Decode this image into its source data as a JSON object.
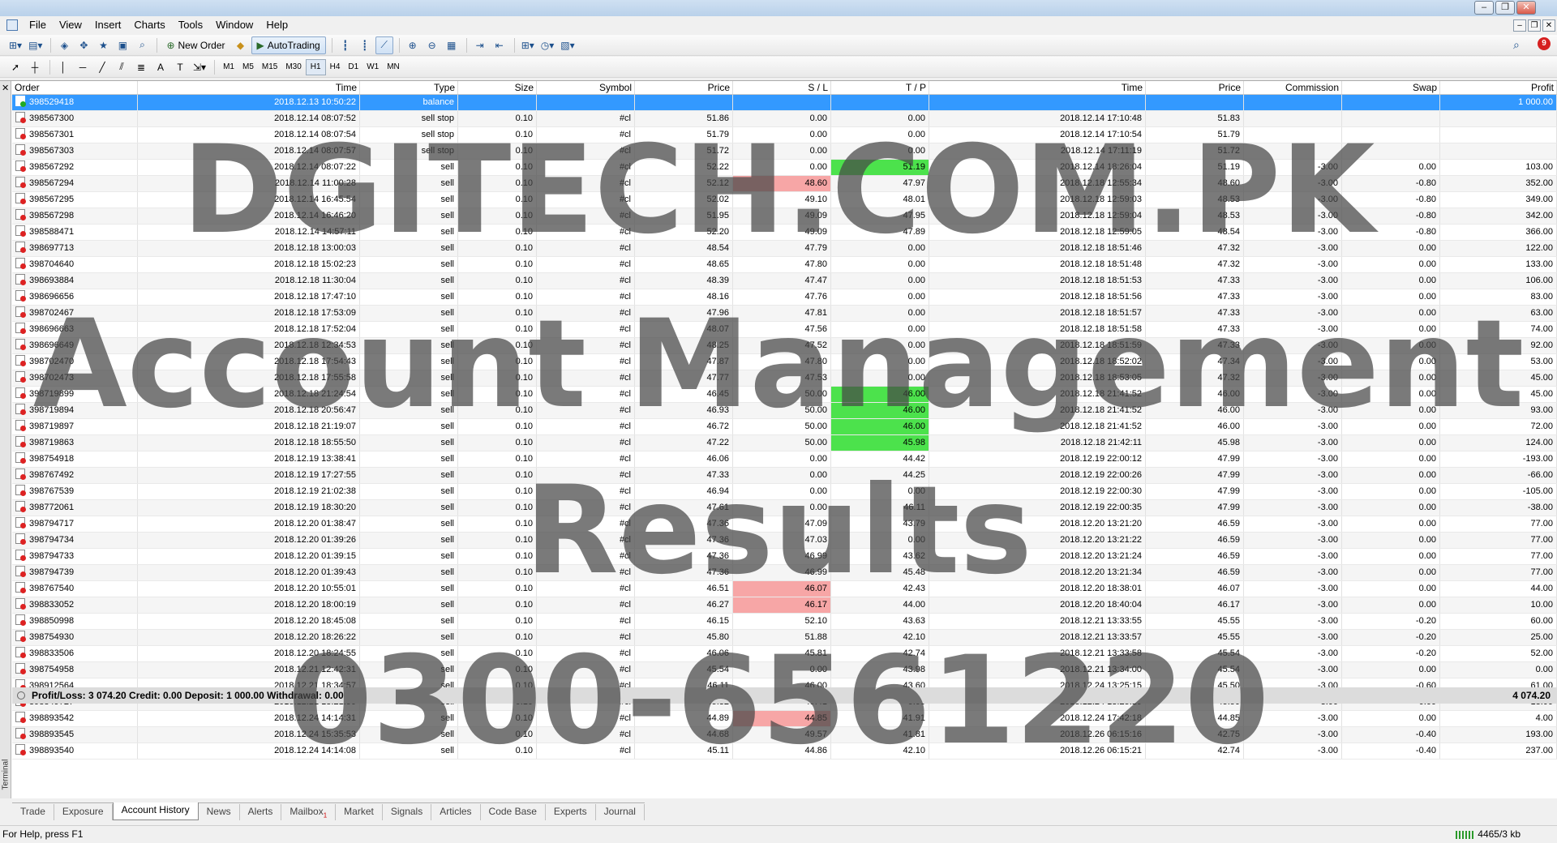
{
  "window_controls": [
    "–",
    "❐",
    "✕"
  ],
  "mdi_controls": [
    "–",
    "❐",
    "✕"
  ],
  "menu": [
    "File",
    "View",
    "Insert",
    "Charts",
    "Tools",
    "Window",
    "Help"
  ],
  "toolbar": {
    "new_order": "New Order",
    "autotrading": "AutoTrading",
    "timeframes": [
      "M1",
      "M5",
      "M15",
      "M30",
      "H1",
      "H4",
      "D1",
      "W1",
      "MN"
    ],
    "active_timeframe": "H1"
  },
  "notifications": {
    "count": "9"
  },
  "columns": [
    "Order",
    "Time",
    "Type",
    "Size",
    "Symbol",
    "Price",
    "S / L",
    "T / P",
    "Time",
    "Price",
    "Commission",
    "Swap",
    "Profit"
  ],
  "rows": [
    {
      "order": "398529418",
      "time": "2018.12.13 10:50:22",
      "type": "balance",
      "size": "",
      "symbol": "",
      "price": "",
      "sl": "",
      "tp": "",
      "ctime": "",
      "cprice": "",
      "commission": "",
      "swap": "",
      "profit": "1 000.00",
      "sel": true,
      "icon": "bal"
    },
    {
      "order": "398567300",
      "time": "2018.12.14 08:07:52",
      "type": "sell stop",
      "size": "0.10",
      "symbol": "#cl",
      "price": "51.86",
      "sl": "0.00",
      "tp": "0.00",
      "ctime": "2018.12.14 17:10:48",
      "cprice": "51.83",
      "commission": "",
      "swap": "",
      "profit": ""
    },
    {
      "order": "398567301",
      "time": "2018.12.14 08:07:54",
      "type": "sell stop",
      "size": "0.10",
      "symbol": "#cl",
      "price": "51.79",
      "sl": "0.00",
      "tp": "0.00",
      "ctime": "2018.12.14 17:10:54",
      "cprice": "51.79",
      "commission": "",
      "swap": "",
      "profit": ""
    },
    {
      "order": "398567303",
      "time": "2018.12.14 08:07:57",
      "type": "sell stop",
      "size": "0.10",
      "symbol": "#cl",
      "price": "51.72",
      "sl": "0.00",
      "tp": "0.00",
      "ctime": "2018.12.14 17:11:19",
      "cprice": "51.72",
      "commission": "",
      "swap": "",
      "profit": ""
    },
    {
      "order": "398567292",
      "time": "2018.12.14 08:07:22",
      "type": "sell",
      "size": "0.10",
      "symbol": "#cl",
      "price": "52.22",
      "sl": "0.00",
      "tp": "51.19",
      "ctime": "2018.12.14 18:26:04",
      "cprice": "51.19",
      "commission": "-3.00",
      "swap": "0.00",
      "profit": "103.00",
      "tphit": true
    },
    {
      "order": "398567294",
      "time": "2018.12.14 11:00:28",
      "type": "sell",
      "size": "0.10",
      "symbol": "#cl",
      "price": "52.12",
      "sl": "48.60",
      "tp": "47.97",
      "ctime": "2018.12.18 12:55:34",
      "cprice": "48.60",
      "commission": "-3.00",
      "swap": "-0.80",
      "profit": "352.00",
      "slhit": true
    },
    {
      "order": "398567295",
      "time": "2018.12.14 16:45:54",
      "type": "sell",
      "size": "0.10",
      "symbol": "#cl",
      "price": "52.02",
      "sl": "49.10",
      "tp": "48.01",
      "ctime": "2018.12.18 12:59:03",
      "cprice": "48.53",
      "commission": "-3.00",
      "swap": "-0.80",
      "profit": "349.00"
    },
    {
      "order": "398567298",
      "time": "2018.12.14 16:46:20",
      "type": "sell",
      "size": "0.10",
      "symbol": "#cl",
      "price": "51.95",
      "sl": "49.09",
      "tp": "47.95",
      "ctime": "2018.12.18 12:59:04",
      "cprice": "48.53",
      "commission": "-3.00",
      "swap": "-0.80",
      "profit": "342.00"
    },
    {
      "order": "398588471",
      "time": "2018.12.14 14:57:11",
      "type": "sell",
      "size": "0.10",
      "symbol": "#cl",
      "price": "52.20",
      "sl": "49.09",
      "tp": "47.89",
      "ctime": "2018.12.18 12:59:05",
      "cprice": "48.54",
      "commission": "-3.00",
      "swap": "-0.80",
      "profit": "366.00"
    },
    {
      "order": "398697713",
      "time": "2018.12.18 13:00:03",
      "type": "sell",
      "size": "0.10",
      "symbol": "#cl",
      "price": "48.54",
      "sl": "47.79",
      "tp": "0.00",
      "ctime": "2018.12.18 18:51:46",
      "cprice": "47.32",
      "commission": "-3.00",
      "swap": "0.00",
      "profit": "122.00"
    },
    {
      "order": "398704640",
      "time": "2018.12.18 15:02:23",
      "type": "sell",
      "size": "0.10",
      "symbol": "#cl",
      "price": "48.65",
      "sl": "47.80",
      "tp": "0.00",
      "ctime": "2018.12.18 18:51:48",
      "cprice": "47.32",
      "commission": "-3.00",
      "swap": "0.00",
      "profit": "133.00"
    },
    {
      "order": "398693884",
      "time": "2018.12.18 11:30:04",
      "type": "sell",
      "size": "0.10",
      "symbol": "#cl",
      "price": "48.39",
      "sl": "47.47",
      "tp": "0.00",
      "ctime": "2018.12.18 18:51:53",
      "cprice": "47.33",
      "commission": "-3.00",
      "swap": "0.00",
      "profit": "106.00"
    },
    {
      "order": "398696656",
      "time": "2018.12.18 17:47:10",
      "type": "sell",
      "size": "0.10",
      "symbol": "#cl",
      "price": "48.16",
      "sl": "47.76",
      "tp": "0.00",
      "ctime": "2018.12.18 18:51:56",
      "cprice": "47.33",
      "commission": "-3.00",
      "swap": "0.00",
      "profit": "83.00"
    },
    {
      "order": "398702467",
      "time": "2018.12.18 17:53:09",
      "type": "sell",
      "size": "0.10",
      "symbol": "#cl",
      "price": "47.96",
      "sl": "47.81",
      "tp": "0.00",
      "ctime": "2018.12.18 18:51:57",
      "cprice": "47.33",
      "commission": "-3.00",
      "swap": "0.00",
      "profit": "63.00"
    },
    {
      "order": "398696663",
      "time": "2018.12.18 17:52:04",
      "type": "sell",
      "size": "0.10",
      "symbol": "#cl",
      "price": "48.07",
      "sl": "47.56",
      "tp": "0.00",
      "ctime": "2018.12.18 18:51:58",
      "cprice": "47.33",
      "commission": "-3.00",
      "swap": "0.00",
      "profit": "74.00"
    },
    {
      "order": "398696649",
      "time": "2018.12.18 12:34:53",
      "type": "sell",
      "size": "0.10",
      "symbol": "#cl",
      "price": "48.25",
      "sl": "47.52",
      "tp": "0.00",
      "ctime": "2018.12.18 18:51:59",
      "cprice": "47.33",
      "commission": "-3.00",
      "swap": "0.00",
      "profit": "92.00"
    },
    {
      "order": "398702470",
      "time": "2018.12.18 17:54:43",
      "type": "sell",
      "size": "0.10",
      "symbol": "#cl",
      "price": "47.87",
      "sl": "47.80",
      "tp": "0.00",
      "ctime": "2018.12.18 18:52:02",
      "cprice": "47.34",
      "commission": "-3.00",
      "swap": "0.00",
      "profit": "53.00"
    },
    {
      "order": "398702473",
      "time": "2018.12.18 17:55:58",
      "type": "sell",
      "size": "0.10",
      "symbol": "#cl",
      "price": "47.77",
      "sl": "47.53",
      "tp": "0.00",
      "ctime": "2018.12.18 18:53:05",
      "cprice": "47.32",
      "commission": "-3.00",
      "swap": "0.00",
      "profit": "45.00"
    },
    {
      "order": "398719899",
      "time": "2018.12.18 21:24:54",
      "type": "sell",
      "size": "0.10",
      "symbol": "#cl",
      "price": "46.45",
      "sl": "50.00",
      "tp": "46.00",
      "ctime": "2018.12.18 21:41:52",
      "cprice": "46.00",
      "commission": "-3.00",
      "swap": "0.00",
      "profit": "45.00",
      "tphit": true
    },
    {
      "order": "398719894",
      "time": "2018.12.18 20:56:47",
      "type": "sell",
      "size": "0.10",
      "symbol": "#cl",
      "price": "46.93",
      "sl": "50.00",
      "tp": "46.00",
      "ctime": "2018.12.18 21:41:52",
      "cprice": "46.00",
      "commission": "-3.00",
      "swap": "0.00",
      "profit": "93.00",
      "tphit": true
    },
    {
      "order": "398719897",
      "time": "2018.12.18 21:19:07",
      "type": "sell",
      "size": "0.10",
      "symbol": "#cl",
      "price": "46.72",
      "sl": "50.00",
      "tp": "46.00",
      "ctime": "2018.12.18 21:41:52",
      "cprice": "46.00",
      "commission": "-3.00",
      "swap": "0.00",
      "profit": "72.00",
      "tphit": true
    },
    {
      "order": "398719863",
      "time": "2018.12.18 18:55:50",
      "type": "sell",
      "size": "0.10",
      "symbol": "#cl",
      "price": "47.22",
      "sl": "50.00",
      "tp": "45.98",
      "ctime": "2018.12.18 21:42:11",
      "cprice": "45.98",
      "commission": "-3.00",
      "swap": "0.00",
      "profit": "124.00",
      "tphit": true
    },
    {
      "order": "398754918",
      "time": "2018.12.19 13:38:41",
      "type": "sell",
      "size": "0.10",
      "symbol": "#cl",
      "price": "46.06",
      "sl": "0.00",
      "tp": "44.42",
      "ctime": "2018.12.19 22:00:12",
      "cprice": "47.99",
      "commission": "-3.00",
      "swap": "0.00",
      "profit": "-193.00"
    },
    {
      "order": "398767492",
      "time": "2018.12.19 17:27:55",
      "type": "sell",
      "size": "0.10",
      "symbol": "#cl",
      "price": "47.33",
      "sl": "0.00",
      "tp": "44.25",
      "ctime": "2018.12.19 22:00:26",
      "cprice": "47.99",
      "commission": "-3.00",
      "swap": "0.00",
      "profit": "-66.00"
    },
    {
      "order": "398767539",
      "time": "2018.12.19 21:02:38",
      "type": "sell",
      "size": "0.10",
      "symbol": "#cl",
      "price": "46.94",
      "sl": "0.00",
      "tp": "0.00",
      "ctime": "2018.12.19 22:00:30",
      "cprice": "47.99",
      "commission": "-3.00",
      "swap": "0.00",
      "profit": "-105.00"
    },
    {
      "order": "398772061",
      "time": "2018.12.19 18:30:20",
      "type": "sell",
      "size": "0.10",
      "symbol": "#cl",
      "price": "47.61",
      "sl": "0.00",
      "tp": "46.11",
      "ctime": "2018.12.19 22:00:35",
      "cprice": "47.99",
      "commission": "-3.00",
      "swap": "0.00",
      "profit": "-38.00"
    },
    {
      "order": "398794717",
      "time": "2018.12.20 01:38:47",
      "type": "sell",
      "size": "0.10",
      "symbol": "#cl",
      "price": "47.36",
      "sl": "47.09",
      "tp": "43.79",
      "ctime": "2018.12.20 13:21:20",
      "cprice": "46.59",
      "commission": "-3.00",
      "swap": "0.00",
      "profit": "77.00"
    },
    {
      "order": "398794734",
      "time": "2018.12.20 01:39:26",
      "type": "sell",
      "size": "0.10",
      "symbol": "#cl",
      "price": "47.36",
      "sl": "47.03",
      "tp": "0.00",
      "ctime": "2018.12.20 13:21:22",
      "cprice": "46.59",
      "commission": "-3.00",
      "swap": "0.00",
      "profit": "77.00"
    },
    {
      "order": "398794733",
      "time": "2018.12.20 01:39:15",
      "type": "sell",
      "size": "0.10",
      "symbol": "#cl",
      "price": "47.36",
      "sl": "46.99",
      "tp": "43.62",
      "ctime": "2018.12.20 13:21:24",
      "cprice": "46.59",
      "commission": "-3.00",
      "swap": "0.00",
      "profit": "77.00"
    },
    {
      "order": "398794739",
      "time": "2018.12.20 01:39:43",
      "type": "sell",
      "size": "0.10",
      "symbol": "#cl",
      "price": "47.36",
      "sl": "46.99",
      "tp": "45.48",
      "ctime": "2018.12.20 13:21:34",
      "cprice": "46.59",
      "commission": "-3.00",
      "swap": "0.00",
      "profit": "77.00"
    },
    {
      "order": "398767540",
      "time": "2018.12.20 10:55:01",
      "type": "sell",
      "size": "0.10",
      "symbol": "#cl",
      "price": "46.51",
      "sl": "46.07",
      "tp": "42.43",
      "ctime": "2018.12.20 18:38:01",
      "cprice": "46.07",
      "commission": "-3.00",
      "swap": "0.00",
      "profit": "44.00",
      "slhit": true
    },
    {
      "order": "398833052",
      "time": "2018.12.20 18:00:19",
      "type": "sell",
      "size": "0.10",
      "symbol": "#cl",
      "price": "46.27",
      "sl": "46.17",
      "tp": "44.00",
      "ctime": "2018.12.20 18:40:04",
      "cprice": "46.17",
      "commission": "-3.00",
      "swap": "0.00",
      "profit": "10.00",
      "slhit": true
    },
    {
      "order": "398850998",
      "time": "2018.12.20 18:45:08",
      "type": "sell",
      "size": "0.10",
      "symbol": "#cl",
      "price": "46.15",
      "sl": "52.10",
      "tp": "43.63",
      "ctime": "2018.12.21 13:33:55",
      "cprice": "45.55",
      "commission": "-3.00",
      "swap": "-0.20",
      "profit": "60.00"
    },
    {
      "order": "398754930",
      "time": "2018.12.20 18:26:22",
      "type": "sell",
      "size": "0.10",
      "symbol": "#cl",
      "price": "45.80",
      "sl": "51.88",
      "tp": "42.10",
      "ctime": "2018.12.21 13:33:57",
      "cprice": "45.55",
      "commission": "-3.00",
      "swap": "-0.20",
      "profit": "25.00"
    },
    {
      "order": "398833506",
      "time": "2018.12.20 18:24:55",
      "type": "sell",
      "size": "0.10",
      "symbol": "#cl",
      "price": "46.06",
      "sl": "45.81",
      "tp": "42.74",
      "ctime": "2018.12.21 13:33:58",
      "cprice": "45.54",
      "commission": "-3.00",
      "swap": "-0.20",
      "profit": "52.00"
    },
    {
      "order": "398754958",
      "time": "2018.12.21 12:42:31",
      "type": "sell",
      "size": "0.10",
      "symbol": "#cl",
      "price": "45.54",
      "sl": "0.00",
      "tp": "43.98",
      "ctime": "2018.12.21 13:34:00",
      "cprice": "45.54",
      "commission": "-3.00",
      "swap": "0.00",
      "profit": "0.00"
    },
    {
      "order": "398912564",
      "time": "2018.12.21 18:34:57",
      "type": "sell",
      "size": "0.10",
      "symbol": "#cl",
      "price": "46.11",
      "sl": "46.00",
      "tp": "43.60",
      "ctime": "2018.12.24 13:25:15",
      "cprice": "45.50",
      "commission": "-3.00",
      "swap": "-0.60",
      "profit": "61.00"
    },
    {
      "order": "398849727",
      "time": "2018.12.21 13:21:50",
      "type": "sell",
      "size": "0.10",
      "symbol": "#cl",
      "price": "45.32",
      "sl": "49.41",
      "tp": "0.00",
      "ctime": "2018.12.24 13:25:19",
      "cprice": "45.50",
      "commission": "-3.00",
      "swap": "-0.60",
      "profit": "-18.00"
    },
    {
      "order": "398893542",
      "time": "2018.12.24 14:14:31",
      "type": "sell",
      "size": "0.10",
      "symbol": "#cl",
      "price": "44.89",
      "sl": "44.85",
      "tp": "41.91",
      "ctime": "2018.12.24 17:42:18",
      "cprice": "44.85",
      "commission": "-3.00",
      "swap": "0.00",
      "profit": "4.00",
      "slhit": true
    },
    {
      "order": "398893545",
      "time": "2018.12.24 15:35:53",
      "type": "sell",
      "size": "0.10",
      "symbol": "#cl",
      "price": "44.68",
      "sl": "49.57",
      "tp": "41.81",
      "ctime": "2018.12.26 06:15:16",
      "cprice": "42.75",
      "commission": "-3.00",
      "swap": "-0.40",
      "profit": "193.00"
    },
    {
      "order": "398893540",
      "time": "2018.12.24 14:14:08",
      "type": "sell",
      "size": "0.10",
      "symbol": "#cl",
      "price": "45.11",
      "sl": "44.86",
      "tp": "42.10",
      "ctime": "2018.12.26 06:15:21",
      "cprice": "42.74",
      "commission": "-3.00",
      "swap": "-0.40",
      "profit": "237.00"
    }
  ],
  "summary": {
    "text": "Profit/Loss: 3 074.20  Credit: 0.00  Deposit: 1 000.00  Withdrawal: 0.00",
    "total": "4 074.20"
  },
  "tabs": [
    "Trade",
    "Exposure",
    "Account History",
    "News",
    "Alerts",
    "Mailbox",
    "Market",
    "Signals",
    "Articles",
    "Code Base",
    "Experts",
    "Journal"
  ],
  "tab_badges": {
    "Mailbox": "1"
  },
  "active_tab": "Account History",
  "side_label": "Terminal",
  "status": {
    "help": "For Help, press F1",
    "traffic": "4465/3 kb"
  },
  "watermark": {
    "line1": "DGITECH.COM.PK",
    "line2": "Account Management",
    "line3": "Results",
    "line4": "0300-6561220"
  },
  "colors": {
    "selected": "#3399ff",
    "sl_hit": "#f7a6a6",
    "tp_hit": "#4ce24c"
  }
}
